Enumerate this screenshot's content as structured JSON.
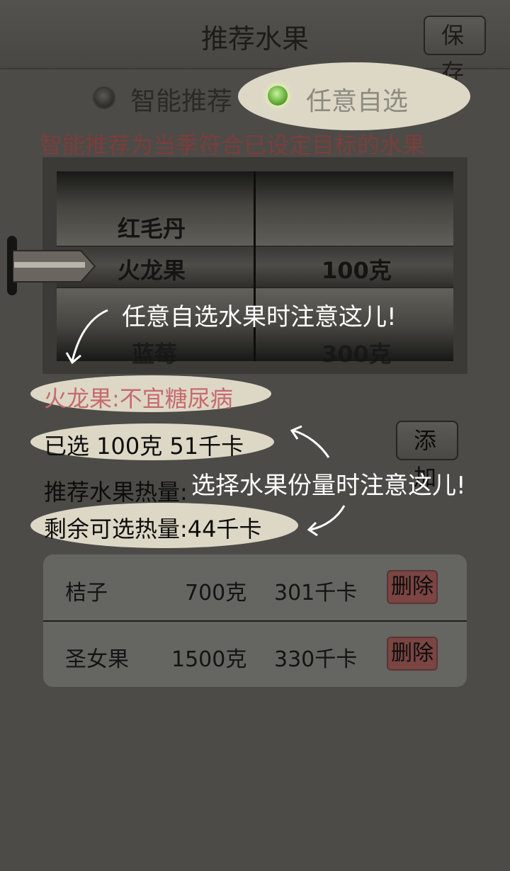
{
  "header": {
    "title": "推荐水果",
    "save_label": "保 存"
  },
  "mode": {
    "option_smart": "智能推荐",
    "option_custom": "任意自选",
    "selected": "任意自选"
  },
  "hint": "智能推荐为当季符合已设定目标的水果",
  "picker": {
    "fruits": [
      "红毛丹",
      "火龙果",
      "蓝莓"
    ],
    "amounts": [
      "100克",
      "300克"
    ],
    "selected_fruit": "火龙果",
    "selected_amount": "100克"
  },
  "annotations": {
    "fruit_tip": "任意自选水果时注意这儿!",
    "amount_tip": "选择水果份量时注意这儿!"
  },
  "info": {
    "warning": "火龙果:不宜糖尿病",
    "selected": "已选 100克 51千卡",
    "recommended_calories": "推荐水果热量:",
    "remaining": "剩余可选热量:44千卡",
    "add_label": "添 加"
  },
  "list": [
    {
      "name": "桔子",
      "amount": "700克",
      "calories": "301千卡",
      "delete_label": "删除"
    },
    {
      "name": "圣女果",
      "amount": "1500克",
      "calories": "330千卡",
      "delete_label": "删除"
    }
  ],
  "colors": {
    "background": "#4c4b47",
    "highlight": "#ddd8c6",
    "warning": "#c66a6e",
    "delete": "#7a4543"
  }
}
